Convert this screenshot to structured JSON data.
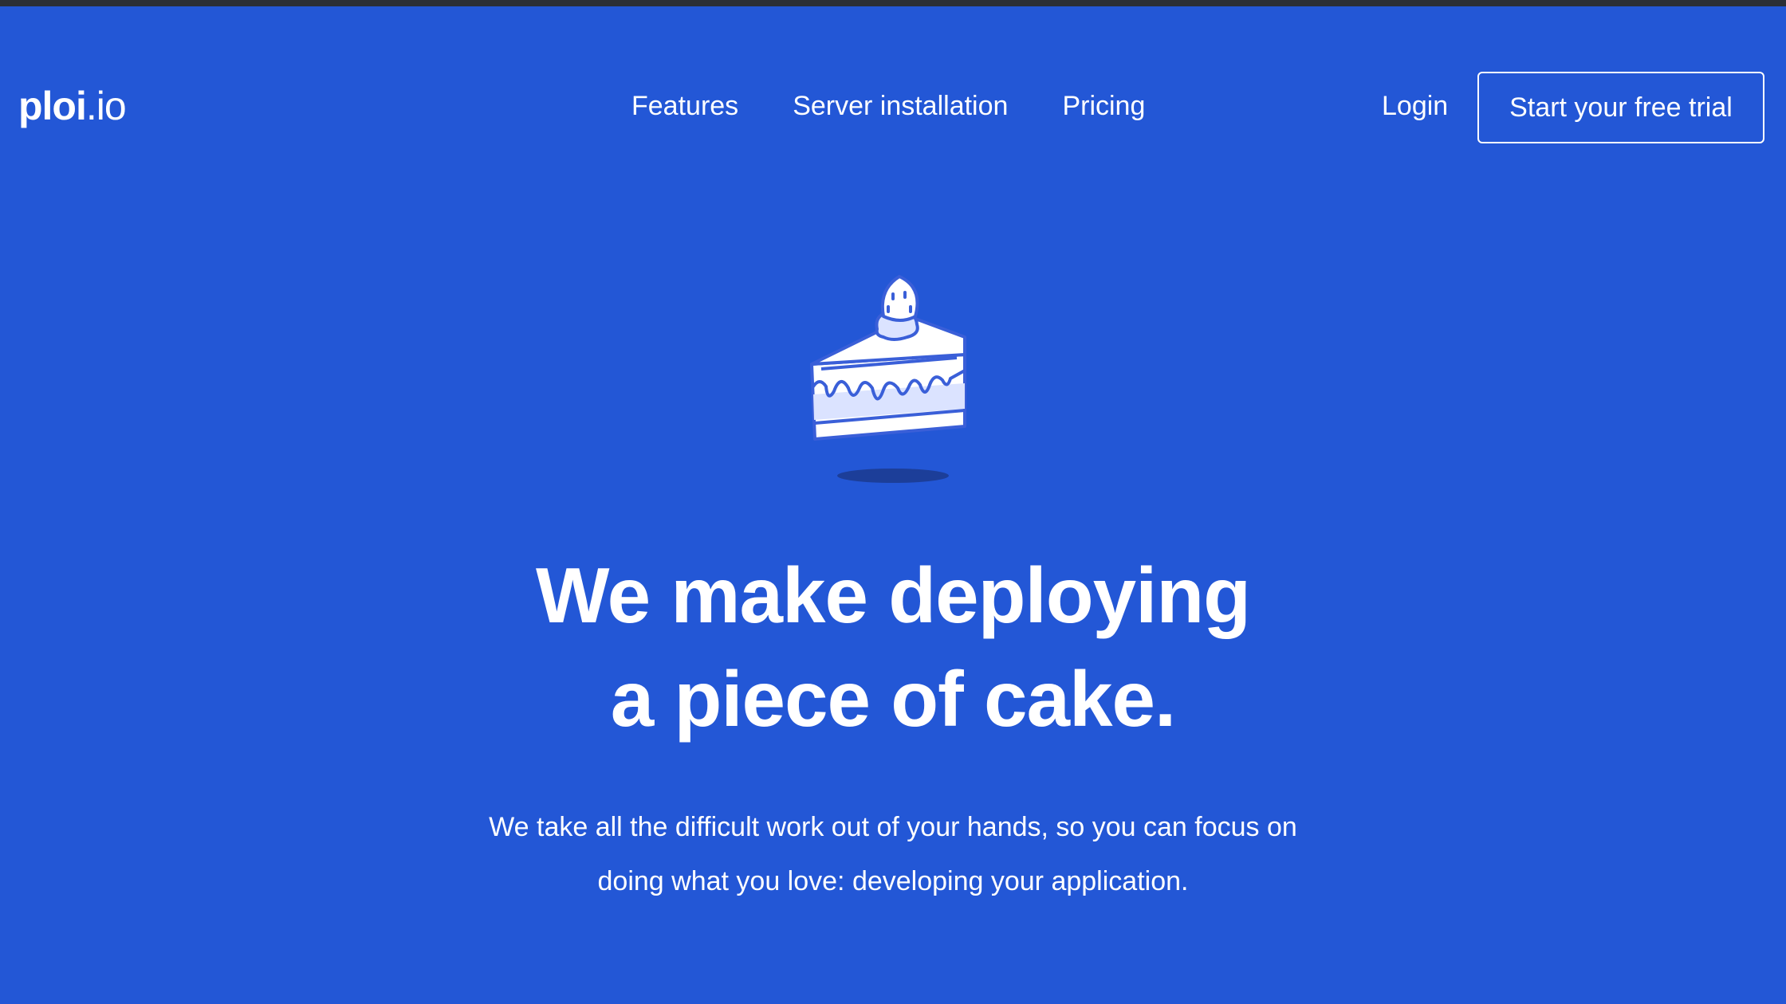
{
  "nav": {
    "logo_main": "ploi",
    "logo_tld": ".io",
    "links": [
      "Features",
      "Server installation",
      "Pricing"
    ],
    "login": "Login",
    "cta": "Start your free trial"
  },
  "hero": {
    "illustration": "cake-slice-icon",
    "headline_line1": "We make deploying",
    "headline_line2": "a piece of cake.",
    "subtext_line1": "We take all the difficult work out of your hands, so you can focus on",
    "subtext_line2": "doing what you love: developing your application."
  },
  "colors": {
    "background": "#2357d6",
    "text": "#ffffff",
    "cake_outline": "#3a5fd8",
    "cake_fill_light": "#dbe3ff"
  }
}
